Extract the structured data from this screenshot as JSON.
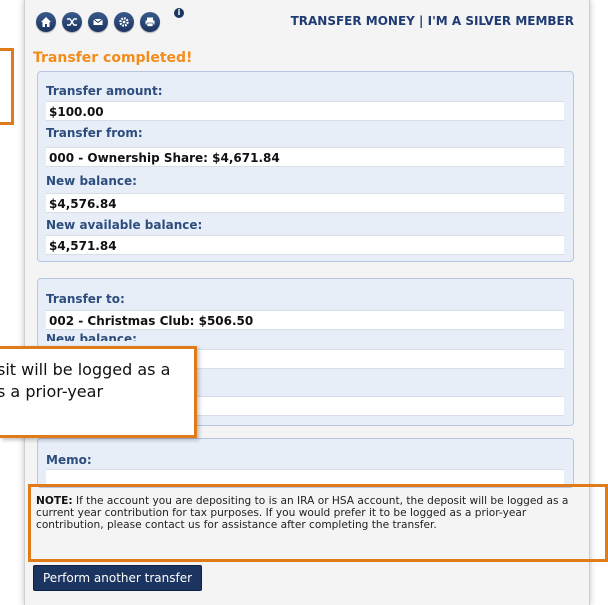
{
  "header": {
    "title": "TRANSFER MONEY | I'M A SILVER MEMBER",
    "icons": [
      "home-icon",
      "shuffle-icon",
      "mail-icon",
      "gear-icon",
      "print-icon",
      "info-icon"
    ]
  },
  "status": "Transfer completed!",
  "from_section": {
    "amount_label": "Transfer amount:",
    "amount_value": "$100.00",
    "from_label": "Transfer from:",
    "from_value": "000 - Ownership Share: $4,671.84",
    "new_balance_label": "New balance:",
    "new_balance_value": "$4,576.84",
    "new_available_label": "New available balance:",
    "new_available_value": "$4,571.84"
  },
  "to_section": {
    "to_label": "Transfer to:",
    "to_value": "002 - Christmas Club: $506.50",
    "partial_label": "New balance:"
  },
  "memo": {
    "label": "Memo:",
    "value": ""
  },
  "callout": {
    "line1": "sit will be logged as a",
    "line2": "s a prior-year"
  },
  "note": {
    "prefix": "NOTE:",
    "text": " If the account you are depositing to is an IRA or HSA account, the deposit will be logged as a current year contribution for tax purposes. If you would prefer it to be logged as a prior-year contribution, please contact us for assistance after completing the transfer."
  },
  "button": {
    "label": "Perform another transfer"
  },
  "colors": {
    "accent": "#e07b1a",
    "primary": "#1c3460",
    "status": "#f28c1c"
  }
}
